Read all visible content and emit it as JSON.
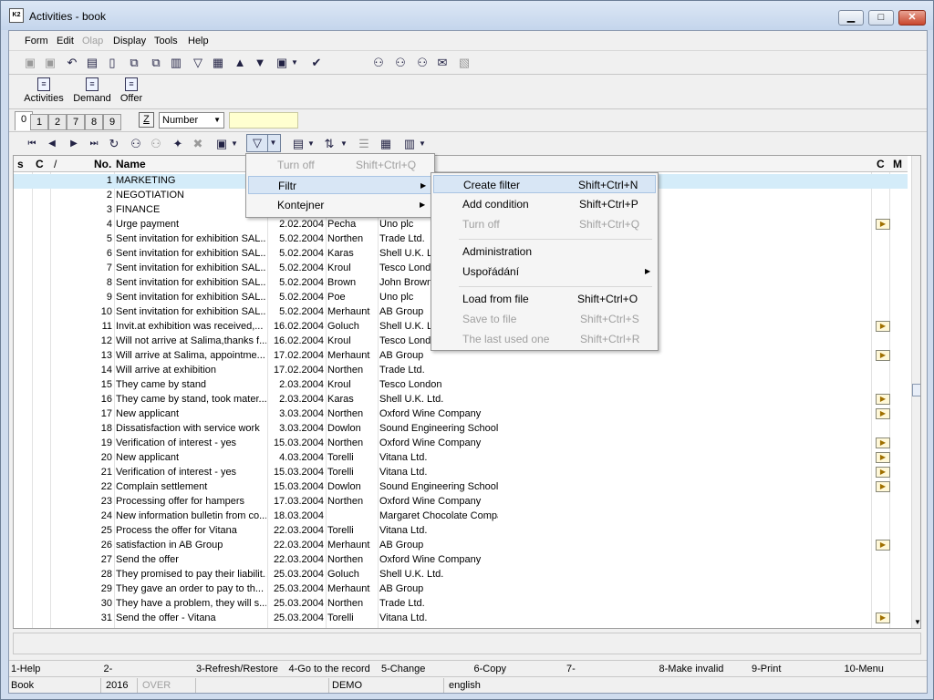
{
  "window": {
    "title": "Activities - book",
    "app_icon_text": "K2"
  },
  "menu": {
    "items": [
      {
        "label": "Form",
        "enabled": true
      },
      {
        "label": "Edit",
        "enabled": true
      },
      {
        "label": "Olap",
        "enabled": false
      },
      {
        "label": "Display",
        "enabled": true
      },
      {
        "label": "Tools",
        "enabled": true
      },
      {
        "label": "Help",
        "enabled": true
      }
    ]
  },
  "toolbar2": {
    "buttons": [
      "Activities",
      "Demand",
      "Offer"
    ]
  },
  "tabs": [
    "0",
    "1",
    "2",
    "7",
    "8",
    "9"
  ],
  "filterbar": {
    "z_label": "Z",
    "sort_value": "Number"
  },
  "grid": {
    "headers": {
      "s": "s",
      "c": "C",
      "slash": "/",
      "no": "No.",
      "name": "Name",
      "c2": "C",
      "m": "M"
    },
    "rows": [
      {
        "no": "1",
        "name": "MARKETING",
        "date": "",
        "user": "",
        "firm": "",
        "icon": false
      },
      {
        "no": "2",
        "name": "NEGOTIATION",
        "date": "",
        "user": "",
        "firm": "",
        "icon": false
      },
      {
        "no": "3",
        "name": "FINANCE",
        "date": "",
        "user": "",
        "firm": "",
        "icon": false
      },
      {
        "no": "4",
        "name": "Urge payment",
        "date": "2.02.2004",
        "user": "Pecha",
        "firm": "Uno plc",
        "icon": true
      },
      {
        "no": "5",
        "name": "Sent invitation for exhibition SAL...",
        "date": "5.02.2004",
        "user": "Northen",
        "firm": "Trade Ltd.",
        "icon": false
      },
      {
        "no": "6",
        "name": "Sent invitation for exhibition SAL...",
        "date": "5.02.2004",
        "user": "Karas",
        "firm": "Shell U.K. L",
        "icon": false
      },
      {
        "no": "7",
        "name": "Sent invitation for exhibition SAL...",
        "date": "5.02.2004",
        "user": "Kroul",
        "firm": "Tesco Lond",
        "icon": false
      },
      {
        "no": "8",
        "name": "Sent invitation for exhibition SAL...",
        "date": "5.02.2004",
        "user": "Brown",
        "firm": "John Brown",
        "icon": false
      },
      {
        "no": "9",
        "name": "Sent invitation for exhibition SAL...",
        "date": "5.02.2004",
        "user": "Poe",
        "firm": "Uno plc",
        "icon": false
      },
      {
        "no": "10",
        "name": "Sent invitation for exhibition SAL...",
        "date": "5.02.2004",
        "user": "Merhaunt",
        "firm": "AB Group",
        "icon": false
      },
      {
        "no": "11",
        "name": "Invit.at exhibition was received,...",
        "date": "16.02.2004",
        "user": "Goluch",
        "firm": "Shell U.K. L",
        "icon": true
      },
      {
        "no": "12",
        "name": "Will not arrive at Salima,thanks f...",
        "date": "16.02.2004",
        "user": "Kroul",
        "firm": "Tesco Lond",
        "icon": false
      },
      {
        "no": "13",
        "name": "Will arrive at Salima, appointme...",
        "date": "17.02.2004",
        "user": "Merhaunt",
        "firm": "AB Group",
        "icon": true
      },
      {
        "no": "14",
        "name": "Will arrive at exhibition",
        "date": "17.02.2004",
        "user": "Northen",
        "firm": "Trade Ltd.",
        "icon": false
      },
      {
        "no": "15",
        "name": "They came by stand",
        "date": "2.03.2004",
        "user": "Kroul",
        "firm": "Tesco London",
        "icon": false
      },
      {
        "no": "16",
        "name": "They came by stand, took mater...",
        "date": "2.03.2004",
        "user": "Karas",
        "firm": "Shell U.K. Ltd.",
        "icon": true
      },
      {
        "no": "17",
        "name": "New applicant",
        "date": "3.03.2004",
        "user": "Northen",
        "firm": "Oxford Wine Company",
        "icon": true
      },
      {
        "no": "18",
        "name": "Dissatisfaction with service work",
        "date": "3.03.2004",
        "user": "Dowlon",
        "firm": "Sound Engineering School",
        "icon": false
      },
      {
        "no": "19",
        "name": "Verification of interest - yes",
        "date": "15.03.2004",
        "user": "Northen",
        "firm": "Oxford Wine Company",
        "icon": true
      },
      {
        "no": "20",
        "name": "New applicant",
        "date": "4.03.2004",
        "user": "Torelli",
        "firm": "Vitana Ltd.",
        "icon": true
      },
      {
        "no": "21",
        "name": "Verification of interest - yes",
        "date": "15.03.2004",
        "user": "Torelli",
        "firm": "Vitana Ltd.",
        "icon": true
      },
      {
        "no": "22",
        "name": "Complain settlement",
        "date": "15.03.2004",
        "user": "Dowlon",
        "firm": "Sound Engineering School",
        "icon": true
      },
      {
        "no": "23",
        "name": "Processing offer for hampers",
        "date": "17.03.2004",
        "user": "Northen",
        "firm": "Oxford Wine Company",
        "icon": false
      },
      {
        "no": "24",
        "name": "New information bulletin from co...",
        "date": "18.03.2004",
        "user": "",
        "firm": "Margaret Chocolate Company,",
        "icon": false
      },
      {
        "no": "25",
        "name": "Process the offer for Vitana",
        "date": "22.03.2004",
        "user": "Torelli",
        "firm": "Vitana Ltd.",
        "icon": false
      },
      {
        "no": "26",
        "name": "satisfaction in AB Group",
        "date": "22.03.2004",
        "user": "Merhaunt",
        "firm": "AB Group",
        "icon": true
      },
      {
        "no": "27",
        "name": "Send the offer",
        "date": "22.03.2004",
        "user": "Northen",
        "firm": "Oxford Wine Company",
        "icon": false
      },
      {
        "no": "28",
        "name": "They promised to pay their liabilit...",
        "date": "25.03.2004",
        "user": "Goluch",
        "firm": "Shell U.K. Ltd.",
        "icon": false
      },
      {
        "no": "29",
        "name": "They gave an order to pay to th...",
        "date": "25.03.2004",
        "user": "Merhaunt",
        "firm": "AB Group",
        "icon": false
      },
      {
        "no": "30",
        "name": "They have a problem, they will s...",
        "date": "25.03.2004",
        "user": "Northen",
        "firm": "Trade Ltd.",
        "icon": false
      },
      {
        "no": "31",
        "name": "Send the offer - Vitana",
        "date": "25.03.2004",
        "user": "Torelli",
        "firm": "Vitana Ltd.",
        "icon": true
      }
    ]
  },
  "context_menu": {
    "items": [
      {
        "label": "Turn off",
        "shortcut": "Shift+Ctrl+Q",
        "enabled": false,
        "submenu": false
      },
      {
        "label": "Filtr",
        "shortcut": "",
        "enabled": true,
        "submenu": true
      },
      {
        "label": "Kontejner",
        "shortcut": "",
        "enabled": true,
        "submenu": true
      }
    ]
  },
  "submenu": {
    "items": [
      {
        "label": "Create filter",
        "shortcut": "Shift+Ctrl+N",
        "enabled": true,
        "submenu": false
      },
      {
        "label": "Add condition",
        "shortcut": "Shift+Ctrl+P",
        "enabled": true,
        "submenu": false
      },
      {
        "label": "Turn off",
        "shortcut": "Shift+Ctrl+Q",
        "enabled": false,
        "submenu": false
      },
      {
        "label": "Administration",
        "shortcut": "",
        "enabled": true,
        "submenu": false
      },
      {
        "label": "Uspořádání",
        "shortcut": "",
        "enabled": true,
        "submenu": true
      },
      {
        "label": "Load from file",
        "shortcut": "Shift+Ctrl+O",
        "enabled": true,
        "submenu": false
      },
      {
        "label": "Save to file",
        "shortcut": "Shift+Ctrl+S",
        "enabled": false,
        "submenu": false
      },
      {
        "label": "The last used one",
        "shortcut": "Shift+Ctrl+R",
        "enabled": false,
        "submenu": false
      }
    ]
  },
  "function_keys": [
    "1-Help",
    "2-",
    "3-Refresh/Restore",
    "4-Go to the record",
    "5-Change",
    "6-Copy",
    "7-",
    "8-Make invalid",
    "9-Print",
    "10-Menu"
  ],
  "status": {
    "book": "Book",
    "year": "2016",
    "mode": "OVER",
    "db": "DEMO",
    "language": "english"
  },
  "colors": {
    "titlebar": "#cfdcee",
    "selected_row": "#d4ecf9",
    "search_bg": "#ffffd0",
    "menu_highlight": "#d8e6f5"
  }
}
